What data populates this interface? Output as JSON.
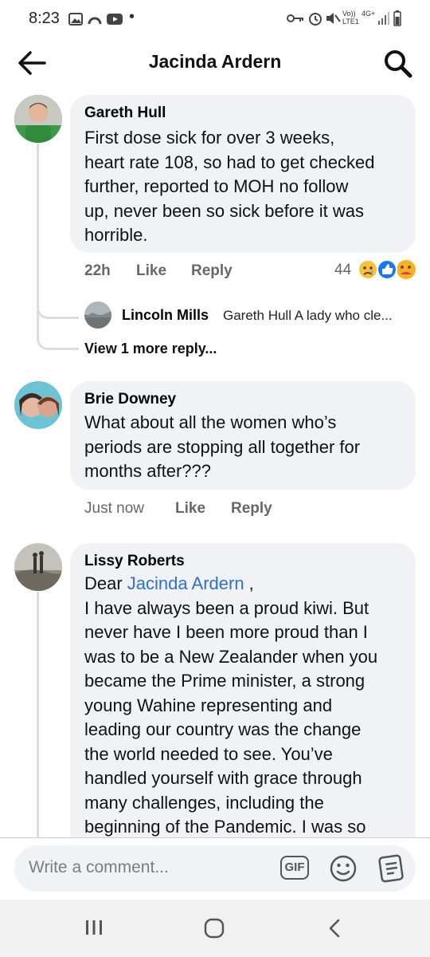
{
  "status_bar": {
    "time": "8:23",
    "dot": "•",
    "network": "4G+",
    "lte": "LTE1"
  },
  "header": {
    "title": "Jacinda Ardern"
  },
  "comments": [
    {
      "author": "Gareth Hull",
      "lines": [
        "First dose sick for over 3 weeks,",
        "heart rate 108, so had to get checked",
        "further, reported to MOH no follow",
        "up, never been so sick before it was",
        "horrible."
      ],
      "time": "22h",
      "like": "Like",
      "reply": "Reply",
      "reaction_count": "44"
    },
    {
      "author": "Brie Downey",
      "lines": [
        "What about all the women who’s",
        "periods are stopping all together for",
        "months after???"
      ],
      "time": "Just now",
      "like": "Like",
      "reply": "Reply"
    },
    {
      "author": "Lissy Roberts",
      "greeting": "Dear ",
      "mention": "Jacinda Ardern",
      "greeting_end": " ,",
      "lines": [
        "I have always been a proud kiwi. But",
        "never have I been more proud than I",
        "was to be a New Zealander when you",
        "became the Prime minister, a strong",
        "young Wahine representing and",
        "leading our country was the change",
        "the world needed to see. You’ve",
        "handled yourself with grace through",
        "many challenges, including the",
        "beginning of the Pandemic. I was so"
      ]
    }
  ],
  "reply_preview": {
    "author": "Lincoln Mills",
    "text": "Gareth Hull A lady who cle..."
  },
  "view_more": "View 1 more reply...",
  "composer": {
    "placeholder": "Write a comment...",
    "gif": "GIF"
  },
  "colors": {
    "bubble": "#f0f2f5",
    "link": "#2f6fd1",
    "meta": "#65676b",
    "like_blue": "#1877f2"
  }
}
